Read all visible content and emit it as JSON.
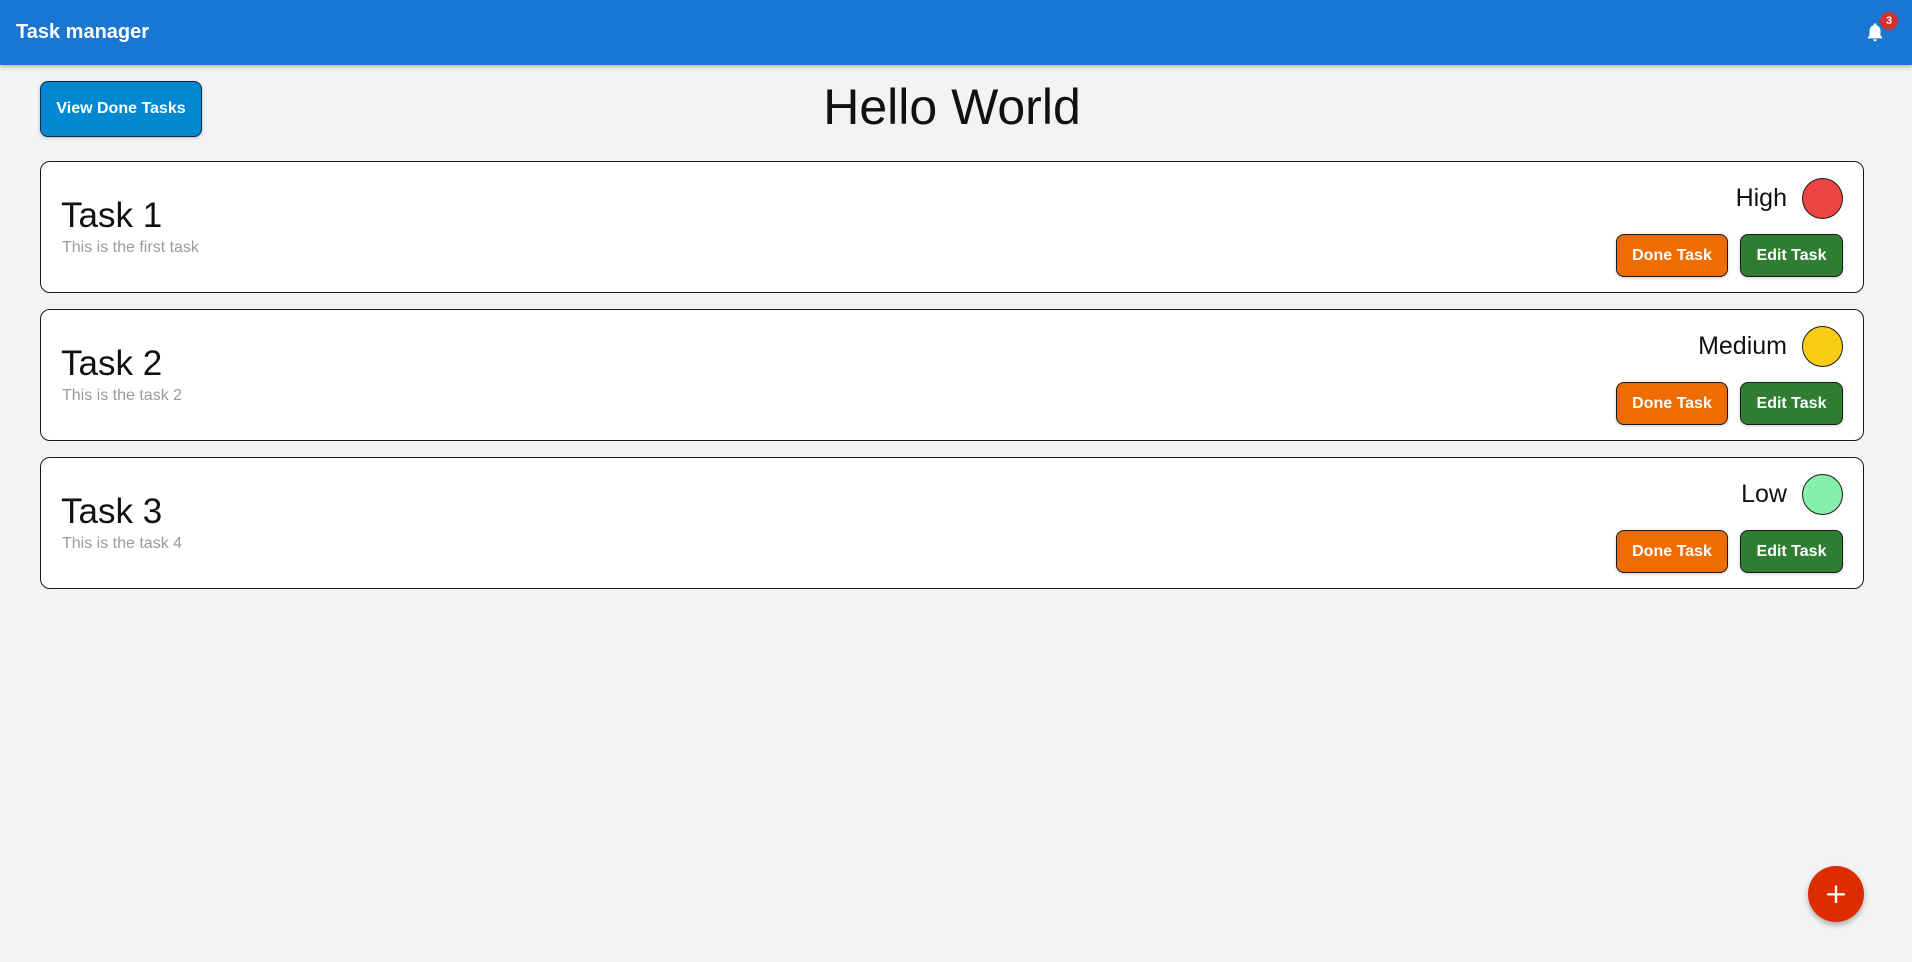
{
  "appbar": {
    "title": "Task manager",
    "notification_count": "3",
    "notification_icon": "bell-icon"
  },
  "header": {
    "view_done_label": "View Done Tasks",
    "page_title": "Hello World"
  },
  "tasks": [
    {
      "title": "Task 1",
      "description": "This is the first task",
      "priority": "High",
      "priority_color": "#ef4444",
      "done_label": "Done Task",
      "edit_label": "Edit Task"
    },
    {
      "title": "Task 2",
      "description": "This is the task 2",
      "priority": "Medium",
      "priority_color": "#facc15",
      "done_label": "Done Task",
      "edit_label": "Edit Task"
    },
    {
      "title": "Task 3",
      "description": "This is the task 4",
      "priority": "Low",
      "priority_color": "#86efac",
      "done_label": "Done Task",
      "edit_label": "Edit Task"
    }
  ],
  "fab": {
    "label": "+",
    "icon": "plus-icon"
  },
  "colors": {
    "appbar": "#1976d2",
    "view_done_button": "#0288d1",
    "done_button": "#ef6c00",
    "edit_button": "#2e7d32",
    "fab": "#dd2c00",
    "badge": "#d32f2f"
  }
}
